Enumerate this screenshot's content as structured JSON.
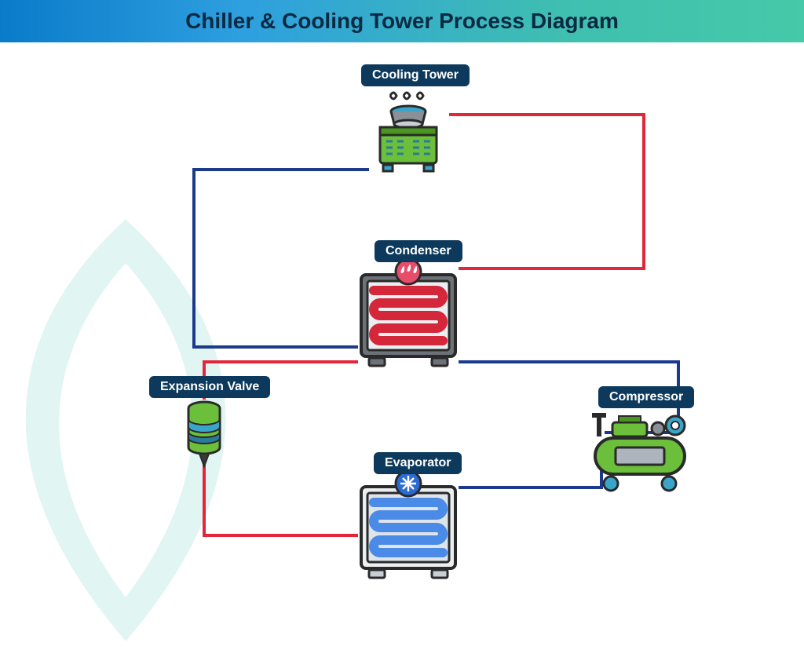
{
  "title": "Chiller & Cooling Tower Process Diagram",
  "nodes": {
    "cooling_tower": {
      "label": "Cooling Tower"
    },
    "condenser": {
      "label": "Condenser"
    },
    "expansion_valve": {
      "label": "Expansion Valve"
    },
    "compressor": {
      "label": "Compressor"
    },
    "evaporator": {
      "label": "Evaporator"
    }
  },
  "loops": [
    {
      "name": "condenser-water-loop",
      "hot_color": "#e4263a",
      "cold_color": "#1b3a8c",
      "between": [
        "cooling_tower",
        "condenser"
      ]
    },
    {
      "name": "refrigerant-loop",
      "hot_color": "#e4263a",
      "cold_color": "#1b3a8c",
      "between": [
        "condenser",
        "expansion_valve",
        "evaporator",
        "compressor"
      ]
    }
  ],
  "colors": {
    "hot": "#e4263a",
    "cold": "#1b3a8c",
    "label_bg": "#0d3a5c",
    "accent_green": "#6bbf3a",
    "accent_teal": "#3aa5c9"
  }
}
